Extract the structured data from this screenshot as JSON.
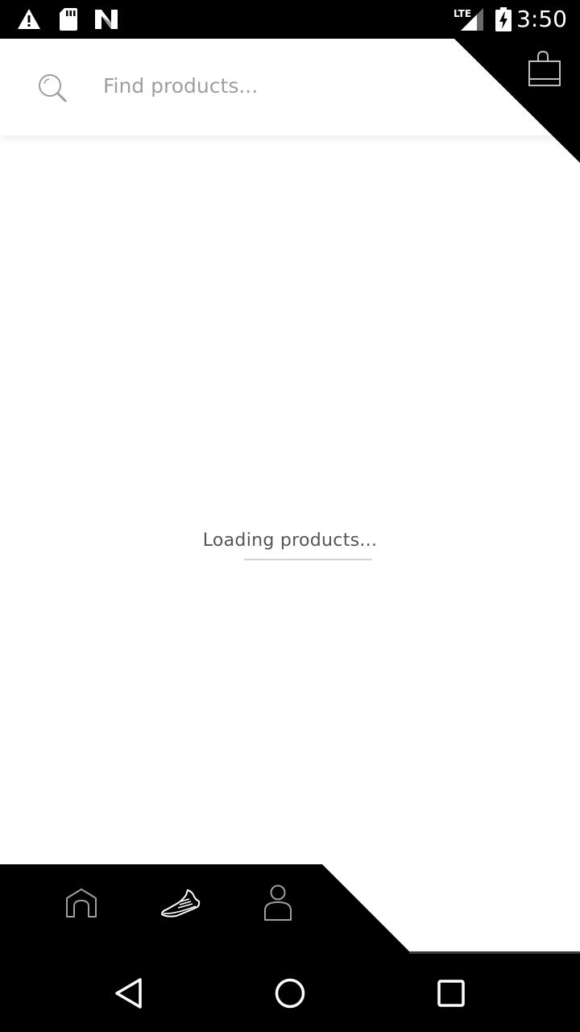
{
  "status_bar": {
    "time": "3:50",
    "network": "LTE",
    "icons": [
      "warning-icon",
      "sd-card-icon",
      "n-notification-icon",
      "lte-signal-icon",
      "battery-charging-icon"
    ]
  },
  "search": {
    "placeholder": "Find products...",
    "value": "",
    "icon": "search-icon"
  },
  "header": {
    "cart_icon": "shopping-bag-icon"
  },
  "main": {
    "loading_text": "Loading products...",
    "loading_progress": 0.0
  },
  "tabbar": {
    "tabs": [
      {
        "icon": "home-icon",
        "active": false
      },
      {
        "icon": "sneaker-icon",
        "active": true
      },
      {
        "icon": "profile-icon",
        "active": false
      }
    ]
  },
  "navbar": {
    "buttons": [
      "back-icon",
      "home-circle-icon",
      "recents-icon"
    ]
  },
  "colors": {
    "bar_background": "#000000",
    "inactive_icon": "#9e9e9e",
    "active_icon": "#ffffff",
    "placeholder": "#9e9e9e"
  }
}
